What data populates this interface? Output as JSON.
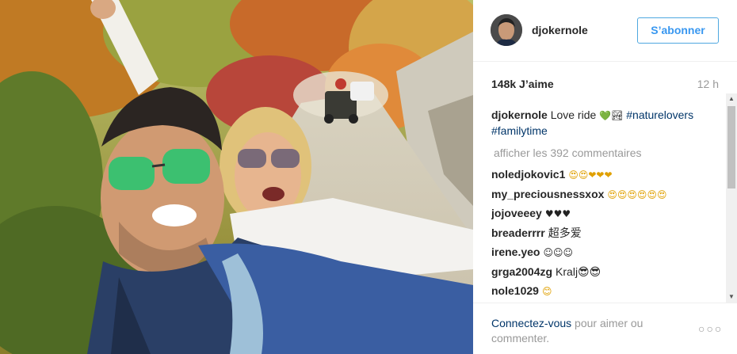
{
  "post": {
    "username": "djokernole",
    "follow_label": "S’abonner",
    "likes": "148k J’aime",
    "age": "12 h",
    "caption": {
      "username": "djokernole",
      "text": "Love ride",
      "heart_icon": "💚",
      "extra_icon": "🏞",
      "hashtags": [
        "#naturelovers",
        "#familytime"
      ]
    },
    "load_more": "afficher les 392 commentaires",
    "comments": [
      {
        "username": "noledjokovic1",
        "text": "😍😍❤❤❤"
      },
      {
        "username": "my_preciousnessxox",
        "text": "😍😍😍😍😍😍"
      },
      {
        "username": "jojoveeey",
        "text": "♥♥♥"
      },
      {
        "username": "breaderrrr",
        "text": "超多爱"
      },
      {
        "username": "irene.yeo",
        "text": "☺☺☺"
      },
      {
        "username": "grga2004zg",
        "text": "Kralj😎😎"
      },
      {
        "username": "nole1029",
        "text": "😊"
      }
    ],
    "login_prompt": {
      "link": "Connectez-vous",
      "rest": " pour aimer ou commenter."
    },
    "more_options": "○○○"
  },
  "colors": {
    "link": "#003569",
    "follow_text": "#3897f0",
    "muted": "#999999"
  }
}
